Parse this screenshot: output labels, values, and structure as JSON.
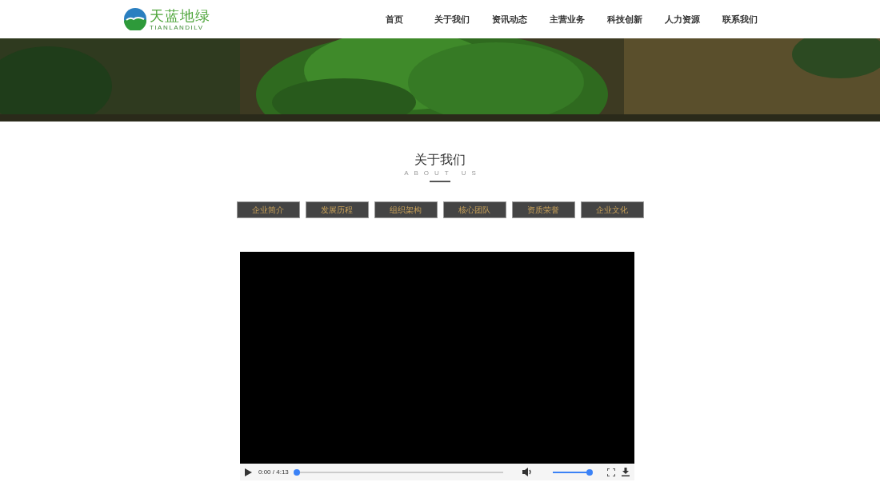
{
  "logo": {
    "name": "天蓝地绿",
    "subtitle": "TIANLANDILV"
  },
  "nav": [
    {
      "label": "首页"
    },
    {
      "label": "关于我们"
    },
    {
      "label": "资讯动态"
    },
    {
      "label": "主营业务"
    },
    {
      "label": "科技创新"
    },
    {
      "label": "人力资源"
    },
    {
      "label": "联系我们"
    }
  ],
  "section": {
    "title": "关于我们",
    "subtitle": "ABOUT US"
  },
  "tabs": [
    {
      "label": "企业简介",
      "selected": false
    },
    {
      "label": "发展历程",
      "selected": false
    },
    {
      "label": "组织架构",
      "selected": false
    },
    {
      "label": "核心团队",
      "selected": false
    },
    {
      "label": "资质荣誉",
      "selected": false
    },
    {
      "label": "企业文化",
      "selected": false
    }
  ],
  "video": {
    "time": "0:00 / 4:13",
    "progress": {
      "level": 0.01
    },
    "volume": {
      "level": 1
    }
  }
}
